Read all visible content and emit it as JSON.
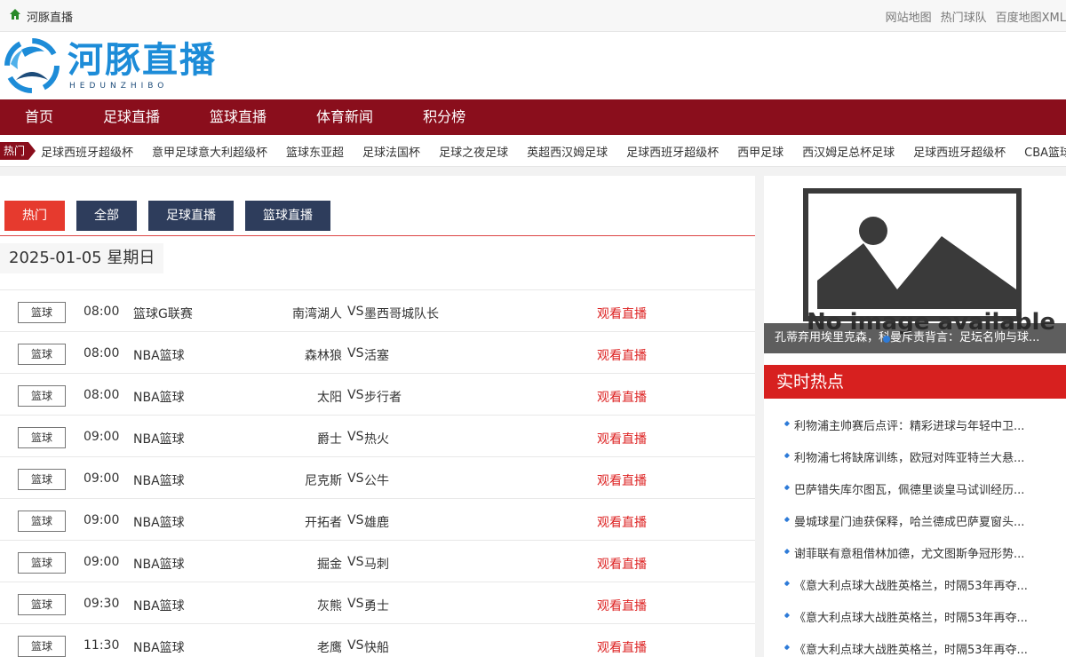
{
  "topbar": {
    "site_name": "河豚直播",
    "links": [
      "网站地图",
      "热门球队",
      "百度地图XML"
    ]
  },
  "header": {
    "logo_text": "河豚直播",
    "logo_sub": "HEDUNZHIBO"
  },
  "nav": {
    "items": [
      "首页",
      "足球直播",
      "篮球直播",
      "体育新闻",
      "积分榜"
    ]
  },
  "ticker": {
    "label": "热门",
    "items": [
      "足球西班牙超级杯",
      "意甲足球意大利超级杯",
      "篮球东亚超",
      "足球法国杯",
      "足球之夜足球",
      "英超西汉姆足球",
      "足球西班牙超级杯",
      "西甲足球",
      "西汉姆足总杯足球",
      "足球西班牙超级杯",
      "CBA篮球"
    ]
  },
  "main": {
    "tabs": [
      "热门",
      "全部",
      "足球直播",
      "篮球直播"
    ],
    "date": "2025-01-05 星期日",
    "watch_label": "观看直播",
    "vs_label": "VS",
    "matches": [
      {
        "cat": "篮球",
        "time": "08:00",
        "league": "篮球G联赛",
        "home": "南湾湖人",
        "away": "墨西哥城队长"
      },
      {
        "cat": "篮球",
        "time": "08:00",
        "league": "NBA篮球",
        "home": "森林狼",
        "away": "活塞"
      },
      {
        "cat": "篮球",
        "time": "08:00",
        "league": "NBA篮球",
        "home": "太阳",
        "away": "步行者"
      },
      {
        "cat": "篮球",
        "time": "09:00",
        "league": "NBA篮球",
        "home": "爵士",
        "away": "热火"
      },
      {
        "cat": "篮球",
        "time": "09:00",
        "league": "NBA篮球",
        "home": "尼克斯",
        "away": "公牛"
      },
      {
        "cat": "篮球",
        "time": "09:00",
        "league": "NBA篮球",
        "home": "开拓者",
        "away": "雄鹿"
      },
      {
        "cat": "篮球",
        "time": "09:00",
        "league": "NBA篮球",
        "home": "掘金",
        "away": "马刺"
      },
      {
        "cat": "篮球",
        "time": "09:30",
        "league": "NBA篮球",
        "home": "灰熊",
        "away": "勇士"
      },
      {
        "cat": "篮球",
        "time": "11:30",
        "league": "NBA篮球",
        "home": "老鹰",
        "away": "快船"
      }
    ]
  },
  "sidebar": {
    "no_image": "No image available",
    "slide_caption": "孔蒂弃用埃里克森，科曼斥责背言：足坛名帅与球...",
    "hot_title": "实时热点",
    "hot_items": [
      "利物浦主帅赛后点评：精彩进球与年轻中卫...",
      "利物浦七将缺席训练，欧冠对阵亚特兰大悬...",
      "巴萨错失库尔图瓦，佩德里谈皇马试训经历...",
      "曼城球星门迪获保释，哈兰德成巴萨夏窗头...",
      "谢菲联有意租借林加德，尤文图斯争冠形势...",
      "《意大利点球大战胜英格兰，时隔53年再夺...",
      "《意大利点球大战胜英格兰，时隔53年再夺...",
      "《意大利点球大战胜英格兰，时隔53年再夺..."
    ]
  },
  "colors": {
    "nav_bg": "#8a0e1c",
    "brand_blue": "#1d8cd8",
    "tab_active": "#e63a2e",
    "tab_default": "#2e3d5c",
    "watch_red": "#d22222",
    "hot_header": "#d7201f"
  },
  "icons": {
    "home": "home-icon",
    "logo": "dolphin-logo-icon",
    "pin": "pin-icon",
    "image_placeholder": "image-placeholder-icon"
  }
}
